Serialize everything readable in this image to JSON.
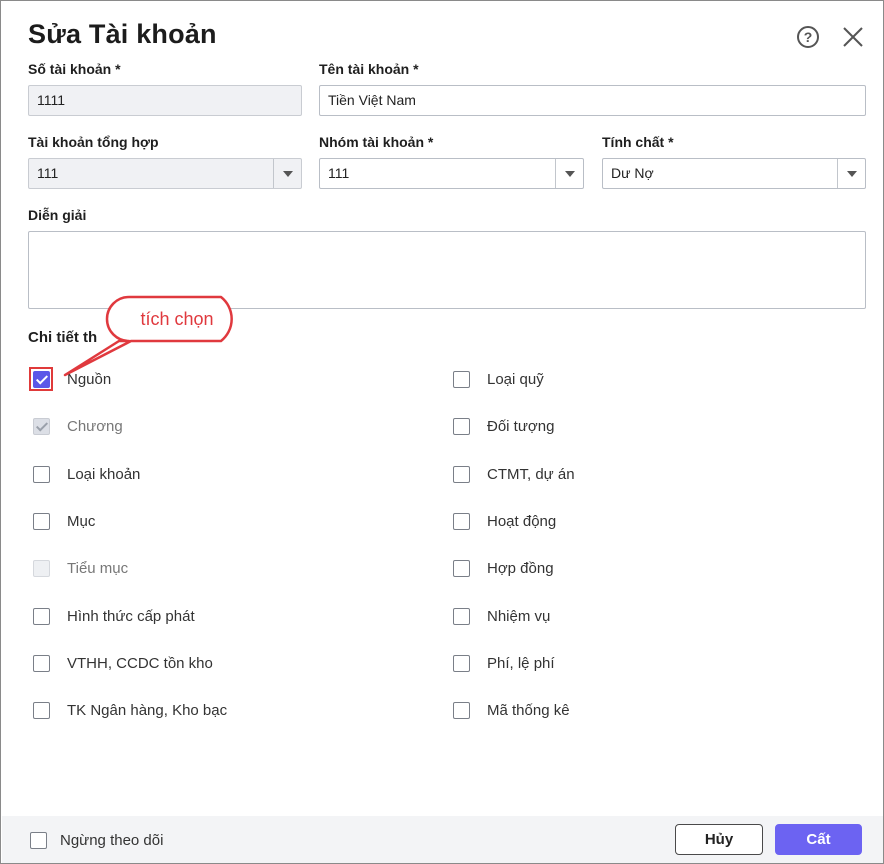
{
  "dialog": {
    "title": "Sửa Tài khoản"
  },
  "header_icons": {
    "help": "question-circle-icon",
    "close": "close-x-icon",
    "help_glyph": "?"
  },
  "fields": {
    "account_number": {
      "label": "Số tài khoản *",
      "value": "1111"
    },
    "account_name": {
      "label": "Tên tài khoản *",
      "value": "Tiền Việt Nam"
    },
    "parent_account": {
      "label": "Tài khoản tổng hợp",
      "value": "111"
    },
    "account_group": {
      "label": "Nhóm tài khoản *",
      "value": "111"
    },
    "nature": {
      "label": "Tính chất *",
      "value": "Dư Nợ"
    },
    "description": {
      "label": "Diễn giải",
      "value": ""
    }
  },
  "details_section": {
    "title": "Chi tiết th",
    "left_options": [
      {
        "label": "Nguồn",
        "state": "checked"
      },
      {
        "label": "Chương",
        "state": "checked-disabled"
      },
      {
        "label": "Loại khoản",
        "state": "unchecked"
      },
      {
        "label": "Mục",
        "state": "unchecked"
      },
      {
        "label": "Tiểu mục",
        "state": "disabled"
      },
      {
        "label": "Hình thức cấp phát",
        "state": "unchecked"
      },
      {
        "label": "VTHH, CCDC tồn kho",
        "state": "unchecked"
      },
      {
        "label": "TK Ngân hàng, Kho bạc",
        "state": "unchecked"
      }
    ],
    "right_options": [
      {
        "label": "Loại quỹ",
        "state": "unchecked"
      },
      {
        "label": "Đối tượng",
        "state": "unchecked"
      },
      {
        "label": "CTMT, dự án",
        "state": "unchecked"
      },
      {
        "label": "Hoạt động",
        "state": "unchecked"
      },
      {
        "label": "Hợp đồng",
        "state": "unchecked"
      },
      {
        "label": "Nhiệm vụ",
        "state": "unchecked"
      },
      {
        "label": "Phí, lệ phí",
        "state": "unchecked"
      },
      {
        "label": "Mã thống kê",
        "state": "unchecked"
      }
    ]
  },
  "annotation": {
    "callout_text": "tích chọn",
    "color": "#e0393e"
  },
  "footer": {
    "stop_tracking_label": "Ngừng theo dõi",
    "stop_tracking_checked": false,
    "cancel_label": "Hủy",
    "save_label": "Cất"
  },
  "colors": {
    "accent": "#6c63f2",
    "checkbox_checked": "#5b57e8",
    "footer_bg": "#f3f4f6"
  }
}
